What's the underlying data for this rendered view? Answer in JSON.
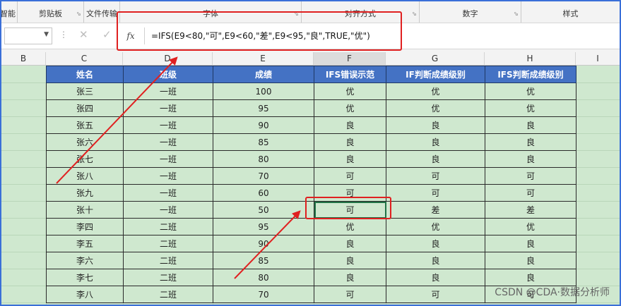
{
  "ribbon": {
    "groups": [
      {
        "label": "智能",
        "launcher": false
      },
      {
        "label": "剪贴板",
        "launcher": true
      },
      {
        "label": "文件传输",
        "launcher": false
      },
      {
        "label": "字体",
        "launcher": true
      },
      {
        "label": "对齐方式",
        "launcher": true
      },
      {
        "label": "数字",
        "launcher": true
      },
      {
        "label": "样式",
        "launcher": false
      }
    ],
    "launcher_glyph": "⬂"
  },
  "formula_bar": {
    "name_box": "",
    "fx_label": "fx",
    "formula": "=IFS(E9<80,\"可\",E9<60,\"差\",E9<95,\"良\",TRUE,\"优\")"
  },
  "columns": [
    "B",
    "C",
    "D",
    "E",
    "F",
    "G",
    "H",
    "I"
  ],
  "selected_column": "F",
  "table": {
    "headers": [
      "姓名",
      "班级",
      "成绩",
      "IFS错误示范",
      "IF判断成绩级别",
      "IFS判断成绩级别"
    ],
    "rows": [
      [
        "张三",
        "一班",
        "100",
        "优",
        "优",
        "优"
      ],
      [
        "张四",
        "一班",
        "95",
        "优",
        "优",
        "优"
      ],
      [
        "张五",
        "一班",
        "90",
        "良",
        "良",
        "良"
      ],
      [
        "张六",
        "一班",
        "85",
        "良",
        "良",
        "良"
      ],
      [
        "张七",
        "一班",
        "80",
        "良",
        "良",
        "良"
      ],
      [
        "张八",
        "一班",
        "70",
        "可",
        "可",
        "可"
      ],
      [
        "张九",
        "一班",
        "60",
        "可",
        "可",
        "可"
      ],
      [
        "张十",
        "一班",
        "50",
        "可",
        "差",
        "差"
      ],
      [
        "李四",
        "二班",
        "95",
        "优",
        "优",
        "优"
      ],
      [
        "李五",
        "二班",
        "90",
        "良",
        "良",
        "良"
      ],
      [
        "李六",
        "二班",
        "85",
        "良",
        "良",
        "良"
      ],
      [
        "李七",
        "二班",
        "80",
        "良",
        "良",
        "良"
      ],
      [
        "李八",
        "二班",
        "70",
        "可",
        "可",
        "可"
      ]
    ],
    "active_cell": {
      "row": 7,
      "col": 3
    }
  },
  "colors": {
    "header_fill": "#4472c4",
    "sheet_fill": "#cfe8cf",
    "annotation": "#e02020"
  },
  "watermark": "CSDN @CDA·数据分析师"
}
